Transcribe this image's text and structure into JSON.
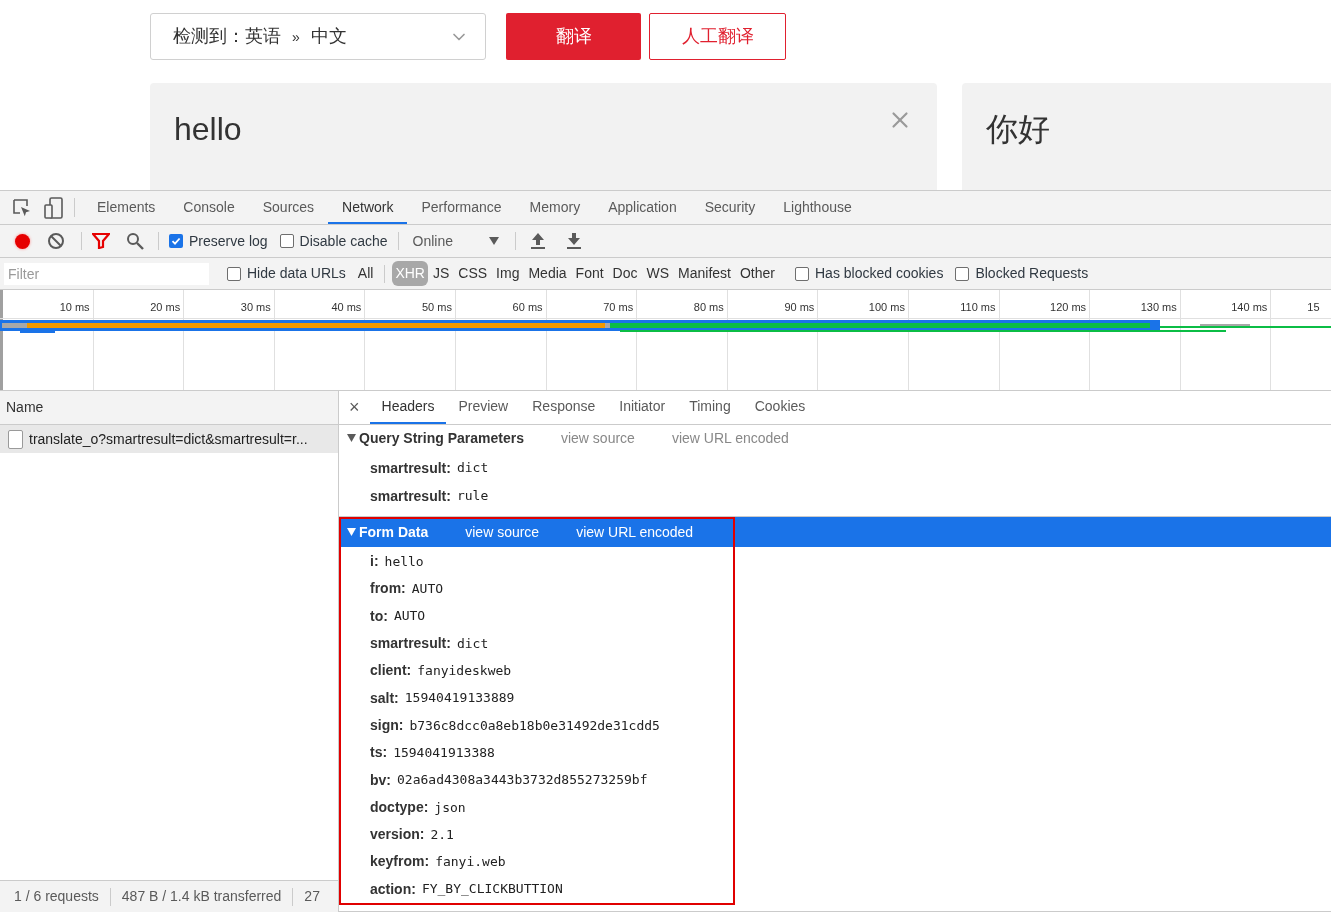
{
  "translator": {
    "language_select": {
      "detected": "检测到：英语",
      "arrow": "»",
      "target": "中文"
    },
    "buttons": [
      {
        "label": "翻译",
        "kind": "primary"
      },
      {
        "label": "人工翻译",
        "kind": "outline"
      }
    ],
    "source_text": "hello",
    "result_text": "你好"
  },
  "devtools": {
    "tabs": [
      {
        "label": "Elements",
        "selected": false
      },
      {
        "label": "Console",
        "selected": false
      },
      {
        "label": "Sources",
        "selected": false
      },
      {
        "label": "Network",
        "selected": true
      },
      {
        "label": "Performance",
        "selected": false
      },
      {
        "label": "Memory",
        "selected": false
      },
      {
        "label": "Application",
        "selected": false
      },
      {
        "label": "Security",
        "selected": false
      },
      {
        "label": "Lighthouse",
        "selected": false
      }
    ],
    "toolbar": {
      "recording": true,
      "preserve_log": {
        "label": "Preserve log",
        "checked": true
      },
      "disable_cache": {
        "label": "Disable cache",
        "checked": false
      },
      "throttle": "Online"
    },
    "filter": {
      "placeholder": "Filter",
      "hide_data_urls": {
        "label": "Hide data URLs",
        "checked": false
      },
      "types": [
        {
          "label": "All",
          "selected": false
        },
        {
          "label": "XHR",
          "selected": true
        },
        {
          "label": "JS",
          "selected": false
        },
        {
          "label": "CSS",
          "selected": false
        },
        {
          "label": "Img",
          "selected": false
        },
        {
          "label": "Media",
          "selected": false
        },
        {
          "label": "Font",
          "selected": false
        },
        {
          "label": "Doc",
          "selected": false
        },
        {
          "label": "WS",
          "selected": false
        },
        {
          "label": "Manifest",
          "selected": false
        },
        {
          "label": "Other",
          "selected": false
        }
      ],
      "has_blocked_cookies": {
        "label": "Has blocked cookies",
        "checked": false
      },
      "blocked_requests": {
        "label": "Blocked Requests",
        "checked": false
      }
    },
    "timeline_ticks": [
      "10 ms",
      "20 ms",
      "30 ms",
      "40 ms",
      "50 ms",
      "60 ms",
      "70 ms",
      "80 ms",
      "90 ms",
      "100 ms",
      "110 ms",
      "120 ms",
      "130 ms",
      "140 ms",
      "15"
    ],
    "requests": {
      "header": "Name",
      "rows": [
        {
          "name": "translate_o?smartresult=dict&smartresult=r...",
          "selected": true
        }
      ]
    },
    "detail": {
      "close": "×",
      "tabs": [
        {
          "label": "Headers",
          "selected": true
        },
        {
          "label": "Preview",
          "selected": false
        },
        {
          "label": "Response",
          "selected": false
        },
        {
          "label": "Initiator",
          "selected": false
        },
        {
          "label": "Timing",
          "selected": false
        },
        {
          "label": "Cookies",
          "selected": false
        }
      ],
      "sections": [
        {
          "title": "Query String Parameters",
          "links": [
            "view source",
            "view URL encoded"
          ],
          "expanded": true,
          "selected": false,
          "highlighted": false,
          "params": [
            {
              "key": "smartresult:",
              "value": "dict"
            },
            {
              "key": "smartresult:",
              "value": "rule"
            }
          ]
        },
        {
          "title": "Form Data",
          "links": [
            "view source",
            "view URL encoded"
          ],
          "expanded": true,
          "selected": true,
          "highlighted": true,
          "params": [
            {
              "key": "i:",
              "value": "hello"
            },
            {
              "key": "from:",
              "value": "AUTO"
            },
            {
              "key": "to:",
              "value": "AUTO"
            },
            {
              "key": "smartresult:",
              "value": "dict"
            },
            {
              "key": "client:",
              "value": "fanyideskweb"
            },
            {
              "key": "salt:",
              "value": "15940419133889"
            },
            {
              "key": "sign:",
              "value": "b736c8dcc0a8eb18b0e31492de31cdd5"
            },
            {
              "key": "ts:",
              "value": "1594041913388"
            },
            {
              "key": "bv:",
              "value": "02a6ad4308a3443b3732d855273259bf"
            },
            {
              "key": "doctype:",
              "value": "json"
            },
            {
              "key": "version:",
              "value": "2.1"
            },
            {
              "key": "keyfrom:",
              "value": "fanyi.web"
            },
            {
              "key": "action:",
              "value": "FY_BY_CLICKBUTTION"
            }
          ]
        }
      ]
    },
    "status": [
      "1 / 6 requests",
      "487 B / 1.4 kB transferred",
      "27"
    ]
  }
}
